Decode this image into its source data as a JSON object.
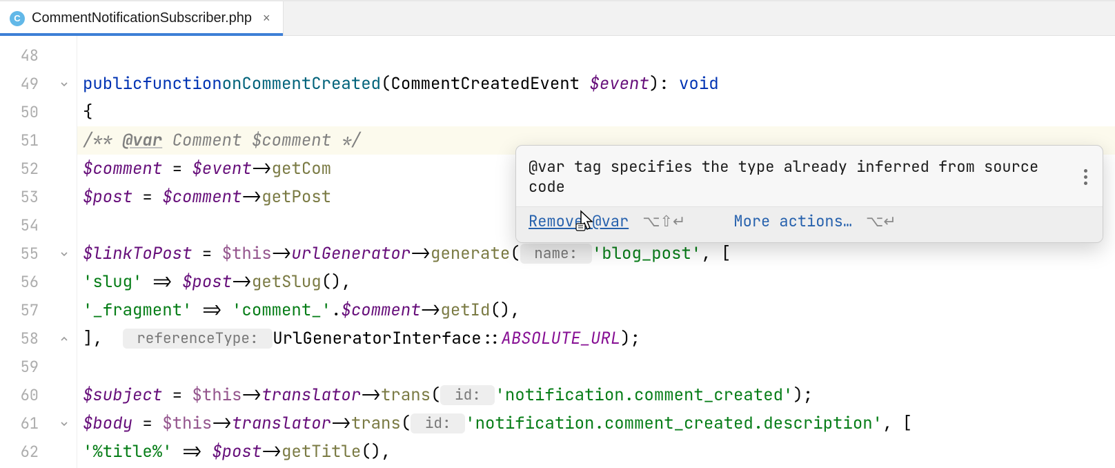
{
  "tab": {
    "icon_letter": "C",
    "filename": "CommentNotificationSubscriber.php"
  },
  "gutter": {
    "lines": [
      "48",
      "49",
      "50",
      "51",
      "52",
      "53",
      "54",
      "55",
      "56",
      "57",
      "58",
      "59",
      "60",
      "61",
      "62"
    ]
  },
  "code": {
    "l49": {
      "kw_public": "public",
      "kw_function": "function",
      "fn": "onCommentCreated",
      "p_open": "(",
      "cls": "CommentCreatedEvent ",
      "var": "$event",
      "p_close": "): ",
      "kw_void": "void"
    },
    "l50": {
      "brace": "{"
    },
    "l51": {
      "c1": "/** ",
      "tag": "@var",
      "rest": " Comment $comment ",
      "c2": "*/"
    },
    "l52": {
      "var1": "$comment",
      "eq": " = ",
      "var2": "$event",
      "arrow": "->",
      "call": "getCom"
    },
    "l53": {
      "var1": "$post",
      "eq": " = ",
      "var2": "$comment",
      "arrow": "->",
      "call": "getPost"
    },
    "l55": {
      "var1": "$linkToPost",
      "eq": " = ",
      "this": "$this",
      "arrow1": "->",
      "prop": "urlGenerator",
      "arrow2": "->",
      "call": "generate",
      "p_open": "(",
      "hint": " name: ",
      "str": "'blog_post'",
      "rest": ", ["
    },
    "l56": {
      "str": "'slug'",
      "arrow": " => ",
      "var": "$post",
      "obj_arrow": "->",
      "call": "getSlug",
      "rest": "(),"
    },
    "l57": {
      "str1": "'_fragment'",
      "arrow": " => ",
      "str2": "'comment_'",
      "dot": ".",
      "var": "$comment",
      "obj_arrow": "->",
      "call": "getId",
      "rest": "(),"
    },
    "l58": {
      "close": "],  ",
      "hint": " referenceType: ",
      "cls": "UrlGeneratorInterface",
      "dcolon": "::",
      "const": "ABSOLUTE_URL",
      "rest": ");"
    },
    "l60": {
      "var1": "$subject",
      "eq": " = ",
      "this": "$this",
      "arrow1": "->",
      "prop": "translator",
      "arrow2": "->",
      "call": "trans",
      "p_open": "(",
      "hint": " id: ",
      "str": "'notification.comment_created'",
      "rest": ");"
    },
    "l61": {
      "var1": "$body",
      "eq": " = ",
      "this": "$this",
      "arrow1": "->",
      "prop": "translator",
      "arrow2": "->",
      "call": "trans",
      "p_open": "(",
      "hint": " id: ",
      "str": "'notification.comment_created.description'",
      "rest": ", ["
    },
    "l62": {
      "str": "'%title%'",
      "arrow": " => ",
      "var": "$post",
      "obj_arrow": "->",
      "call": "getTitle",
      "rest": "(),"
    }
  },
  "popup": {
    "message": "@var tag specifies the type already inferred from source code",
    "remove": "Remove @var",
    "remove_shortcut": "⌥⇧↵",
    "more": "More actions…",
    "more_shortcut": "⌥↵"
  }
}
